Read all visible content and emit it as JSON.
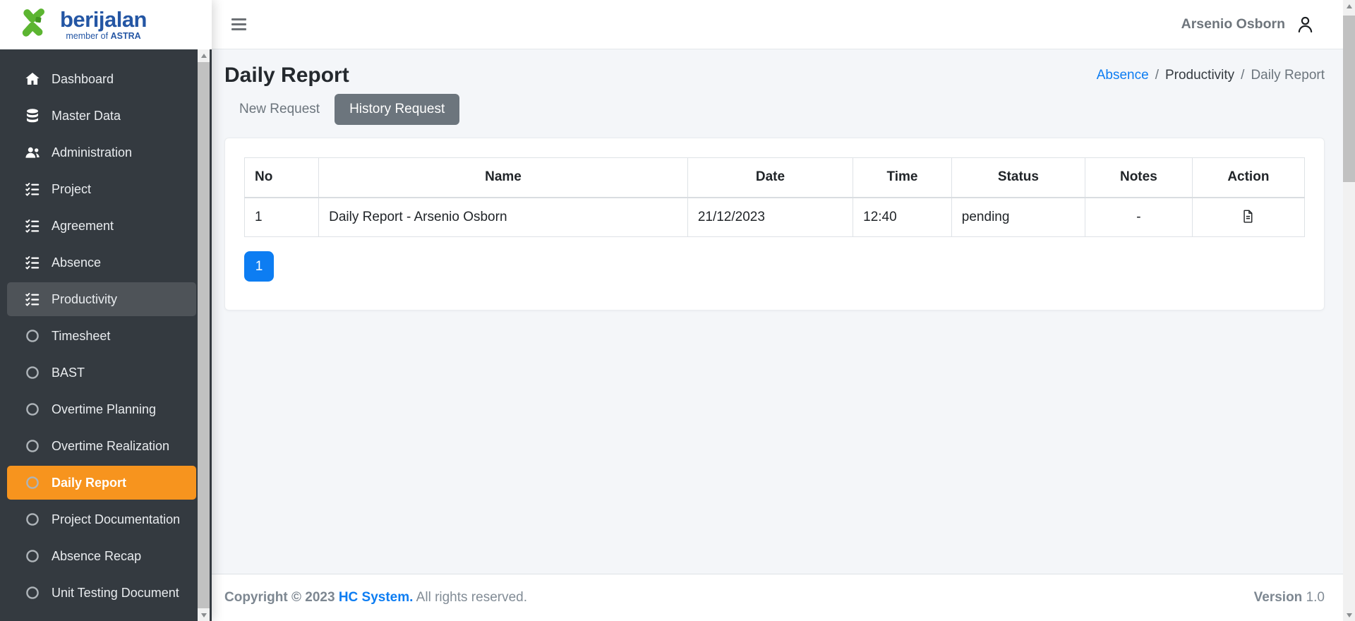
{
  "brand": {
    "name": "berijalan",
    "tagline_prefix": "member of",
    "tagline_brand": "ASTRA"
  },
  "topbar": {
    "user_name": "Arsenio Osborn"
  },
  "sidebar": {
    "items": [
      {
        "label": "Dashboard",
        "icon": "home",
        "type": "parent"
      },
      {
        "label": "Master Data",
        "icon": "database",
        "type": "parent"
      },
      {
        "label": "Administration",
        "icon": "users",
        "type": "parent"
      },
      {
        "label": "Project",
        "icon": "tasks",
        "type": "parent"
      },
      {
        "label": "Agreement",
        "icon": "tasks",
        "type": "parent"
      },
      {
        "label": "Absence",
        "icon": "tasks",
        "type": "parent"
      },
      {
        "label": "Productivity",
        "icon": "tasks",
        "type": "parent",
        "state": "open"
      },
      {
        "label": "Timesheet",
        "icon": "circle",
        "type": "child"
      },
      {
        "label": "BAST",
        "icon": "circle",
        "type": "child"
      },
      {
        "label": "Overtime Planning",
        "icon": "circle",
        "type": "child"
      },
      {
        "label": "Overtime Realization",
        "icon": "circle",
        "type": "child"
      },
      {
        "label": "Daily Report",
        "icon": "circle",
        "type": "child",
        "state": "active"
      },
      {
        "label": "Project Documentation",
        "icon": "circle",
        "type": "child"
      },
      {
        "label": "Absence Recap",
        "icon": "circle",
        "type": "child"
      },
      {
        "label": "Unit Testing Document",
        "icon": "circle",
        "type": "child"
      }
    ]
  },
  "page": {
    "title": "Daily Report",
    "breadcrumb": [
      {
        "label": "Absence",
        "type": "link"
      },
      {
        "label": "Productivity",
        "type": "plain"
      },
      {
        "label": "Daily Report",
        "type": "current"
      }
    ],
    "tabs": [
      {
        "label": "New Request",
        "active": false
      },
      {
        "label": "History Request",
        "active": true
      }
    ]
  },
  "table": {
    "columns": [
      "No",
      "Name",
      "Date",
      "Time",
      "Status",
      "Notes",
      "Action"
    ],
    "rows": [
      {
        "no": "1",
        "name": "Daily Report - Arsenio Osborn",
        "date": "21/12/2023",
        "time": "12:40",
        "status": "pending",
        "notes": "-",
        "action_icon": "file-text"
      }
    ]
  },
  "pagination": {
    "pages": [
      "1"
    ],
    "active": "1"
  },
  "footer": {
    "copyright_bold": "Copyright © 2023",
    "link": "HC System.",
    "rights": "All rights reserved.",
    "version_label": "Version",
    "version_value": "1.0"
  },
  "colors": {
    "sidebar_bg": "#343a40",
    "accent_orange": "#f7941e",
    "accent_blue": "#0d7df2",
    "tab_active_bg": "#6c757d",
    "logo_green": "#5cb531",
    "logo_blue": "#2456a4"
  }
}
